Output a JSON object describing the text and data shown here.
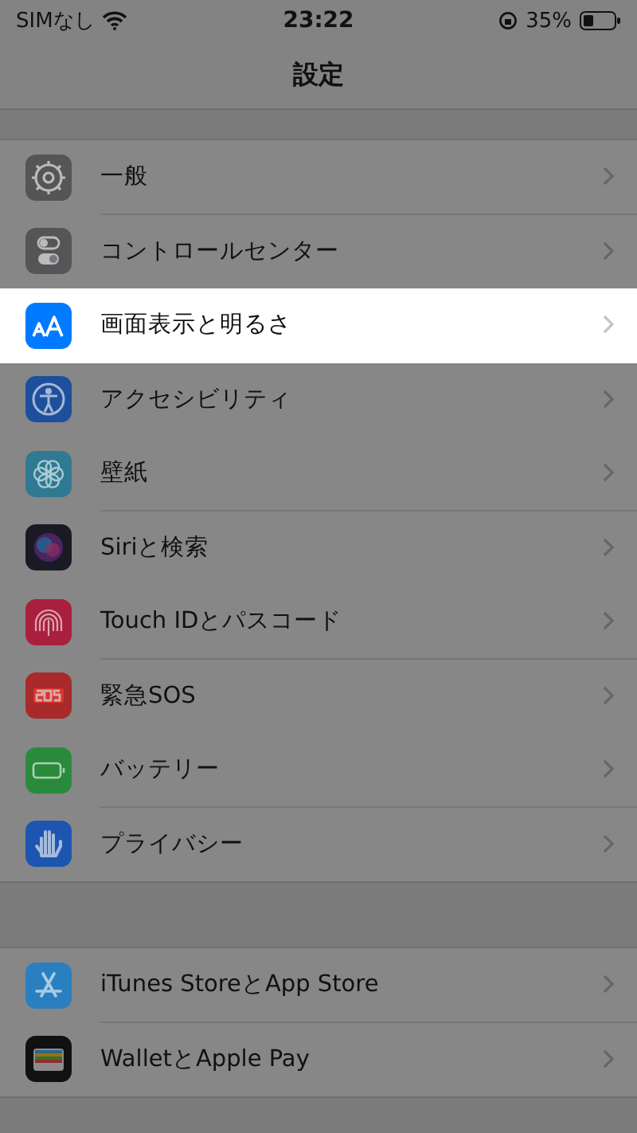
{
  "status_bar": {
    "carrier": "SIMなし",
    "time": "23:22",
    "battery_percent": "35%"
  },
  "nav_bar": {
    "title": "設定"
  },
  "groups": [
    {
      "items": [
        {
          "label": "一般",
          "kind": "gear",
          "color": "#555558",
          "selected": false
        },
        {
          "label": "コントロールセンター",
          "kind": "toggles",
          "color": "#555558",
          "selected": false
        },
        {
          "label": "画面表示と明るさ",
          "kind": "text-size",
          "color": "#007aff",
          "selected": true
        },
        {
          "label": "アクセシビリティ",
          "kind": "person",
          "color": "#1d4f9c",
          "selected": false
        },
        {
          "label": "壁紙",
          "kind": "flower",
          "color": "#2f7a92",
          "selected": false
        },
        {
          "label": "Siriと検索",
          "kind": "orb",
          "color": "#1a1a24",
          "selected": false
        },
        {
          "label": "Touch IDとパスコード",
          "kind": "fingerprint",
          "color": "#a8203e",
          "selected": false
        },
        {
          "label": "緊急SOS",
          "kind": "sos",
          "color": "#a82a2a",
          "selected": false
        },
        {
          "label": "バッテリー",
          "kind": "battery",
          "color": "#2a8a3c",
          "selected": false
        },
        {
          "label": "プライバシー",
          "kind": "hand",
          "color": "#1d56b0",
          "selected": false
        }
      ]
    },
    {
      "items": [
        {
          "label": "iTunes StoreとApp Store",
          "kind": "store",
          "color": "#2a7fc0",
          "selected": false
        },
        {
          "label": "WalletとApple Pay",
          "kind": "wallet",
          "color": "#111111",
          "selected": false
        }
      ]
    }
  ]
}
